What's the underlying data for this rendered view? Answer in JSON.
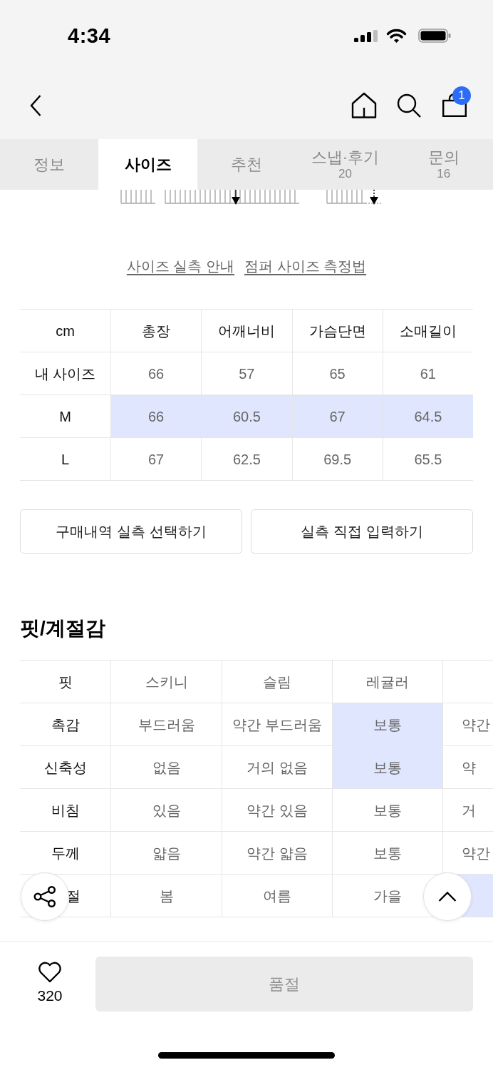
{
  "status_bar": {
    "time": "4:34"
  },
  "nav": {
    "cart_count": "1"
  },
  "tabs": [
    {
      "label": "정보",
      "selected": false
    },
    {
      "label": "사이즈",
      "selected": true
    },
    {
      "label": "추천",
      "selected": false
    },
    {
      "label": "스냅·후기",
      "count": "20",
      "selected": false
    },
    {
      "label": "문의",
      "count": "16",
      "selected": false
    }
  ],
  "size_links": [
    "사이즈 실측 안내",
    "점퍼 사이즈 측정법"
  ],
  "size_table": {
    "columns": [
      "cm",
      "총장",
      "어깨너비",
      "가슴단면",
      "소매길이"
    ],
    "rows": [
      {
        "label": "내 사이즈",
        "values": [
          "66",
          "57",
          "65",
          "61"
        ],
        "selected": false
      },
      {
        "label": "M",
        "values": [
          "66",
          "60.5",
          "67",
          "64.5"
        ],
        "selected": true
      },
      {
        "label": "L",
        "values": [
          "67",
          "62.5",
          "69.5",
          "65.5"
        ],
        "selected": false
      }
    ]
  },
  "size_buttons": [
    "구매내역 실측 선택하기",
    "실측 직접 입력하기"
  ],
  "fit_section": {
    "title": "핏/계절감",
    "rows": [
      {
        "label": "핏",
        "cells": [
          {
            "text": "스키니",
            "selected": false
          },
          {
            "text": "슬림",
            "selected": false
          },
          {
            "text": "레귤러",
            "selected": false
          },
          {
            "selected": false
          }
        ]
      },
      {
        "label": "촉감",
        "cells": [
          {
            "text": "부드러움",
            "selected": false
          },
          {
            "text": "약간 부드러움",
            "selected": false
          },
          {
            "text": "보통",
            "selected": true
          },
          {
            "text": "약간",
            "selected": false
          }
        ]
      },
      {
        "label": "신축성",
        "cells": [
          {
            "text": "없음",
            "selected": false
          },
          {
            "text": "거의 없음",
            "selected": false
          },
          {
            "text": "보통",
            "selected": true
          },
          {
            "text": "약",
            "selected": false
          }
        ]
      },
      {
        "label": "비침",
        "cells": [
          {
            "text": "있음",
            "selected": false
          },
          {
            "text": "약간 있음",
            "selected": false
          },
          {
            "text": "보통",
            "selected": false
          },
          {
            "text": "거",
            "selected": false
          }
        ]
      },
      {
        "label": "두께",
        "cells": [
          {
            "text": "얇음",
            "selected": false
          },
          {
            "text": "약간 얇음",
            "selected": false
          },
          {
            "text": "보통",
            "selected": false
          },
          {
            "text": "약간",
            "selected": false
          }
        ]
      },
      {
        "label": "절",
        "cells": [
          {
            "text": "봄",
            "selected": false
          },
          {
            "text": "여름",
            "selected": false
          },
          {
            "text": "가을",
            "selected": false
          },
          {
            "selected": true
          }
        ]
      }
    ]
  },
  "bottom_bar": {
    "likes": "320",
    "buy_button": {
      "label": "품절",
      "disabled": true
    }
  }
}
